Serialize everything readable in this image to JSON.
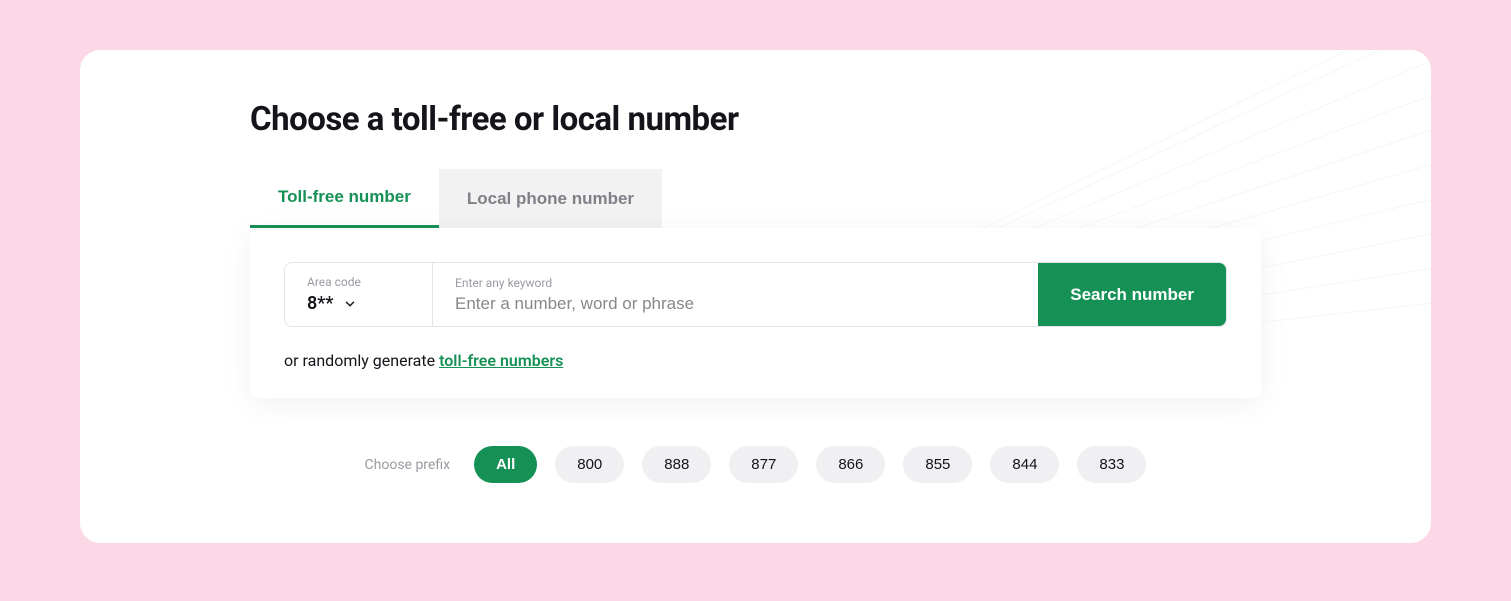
{
  "title": "Choose a toll-free or local number",
  "tabs": {
    "tollfree": "Toll-free number",
    "local": "Local phone number"
  },
  "areaCode": {
    "label": "Area code",
    "value": "8**"
  },
  "keyword": {
    "label": "Enter any keyword",
    "placeholder": "Enter a number, word or phrase"
  },
  "searchButton": "Search number",
  "random": {
    "prefix": "or randomly generate ",
    "link": "toll-free numbers"
  },
  "prefix": {
    "label": "Choose prefix",
    "options": [
      "All",
      "800",
      "888",
      "877",
      "866",
      "855",
      "844",
      "833"
    ],
    "active": "All"
  }
}
